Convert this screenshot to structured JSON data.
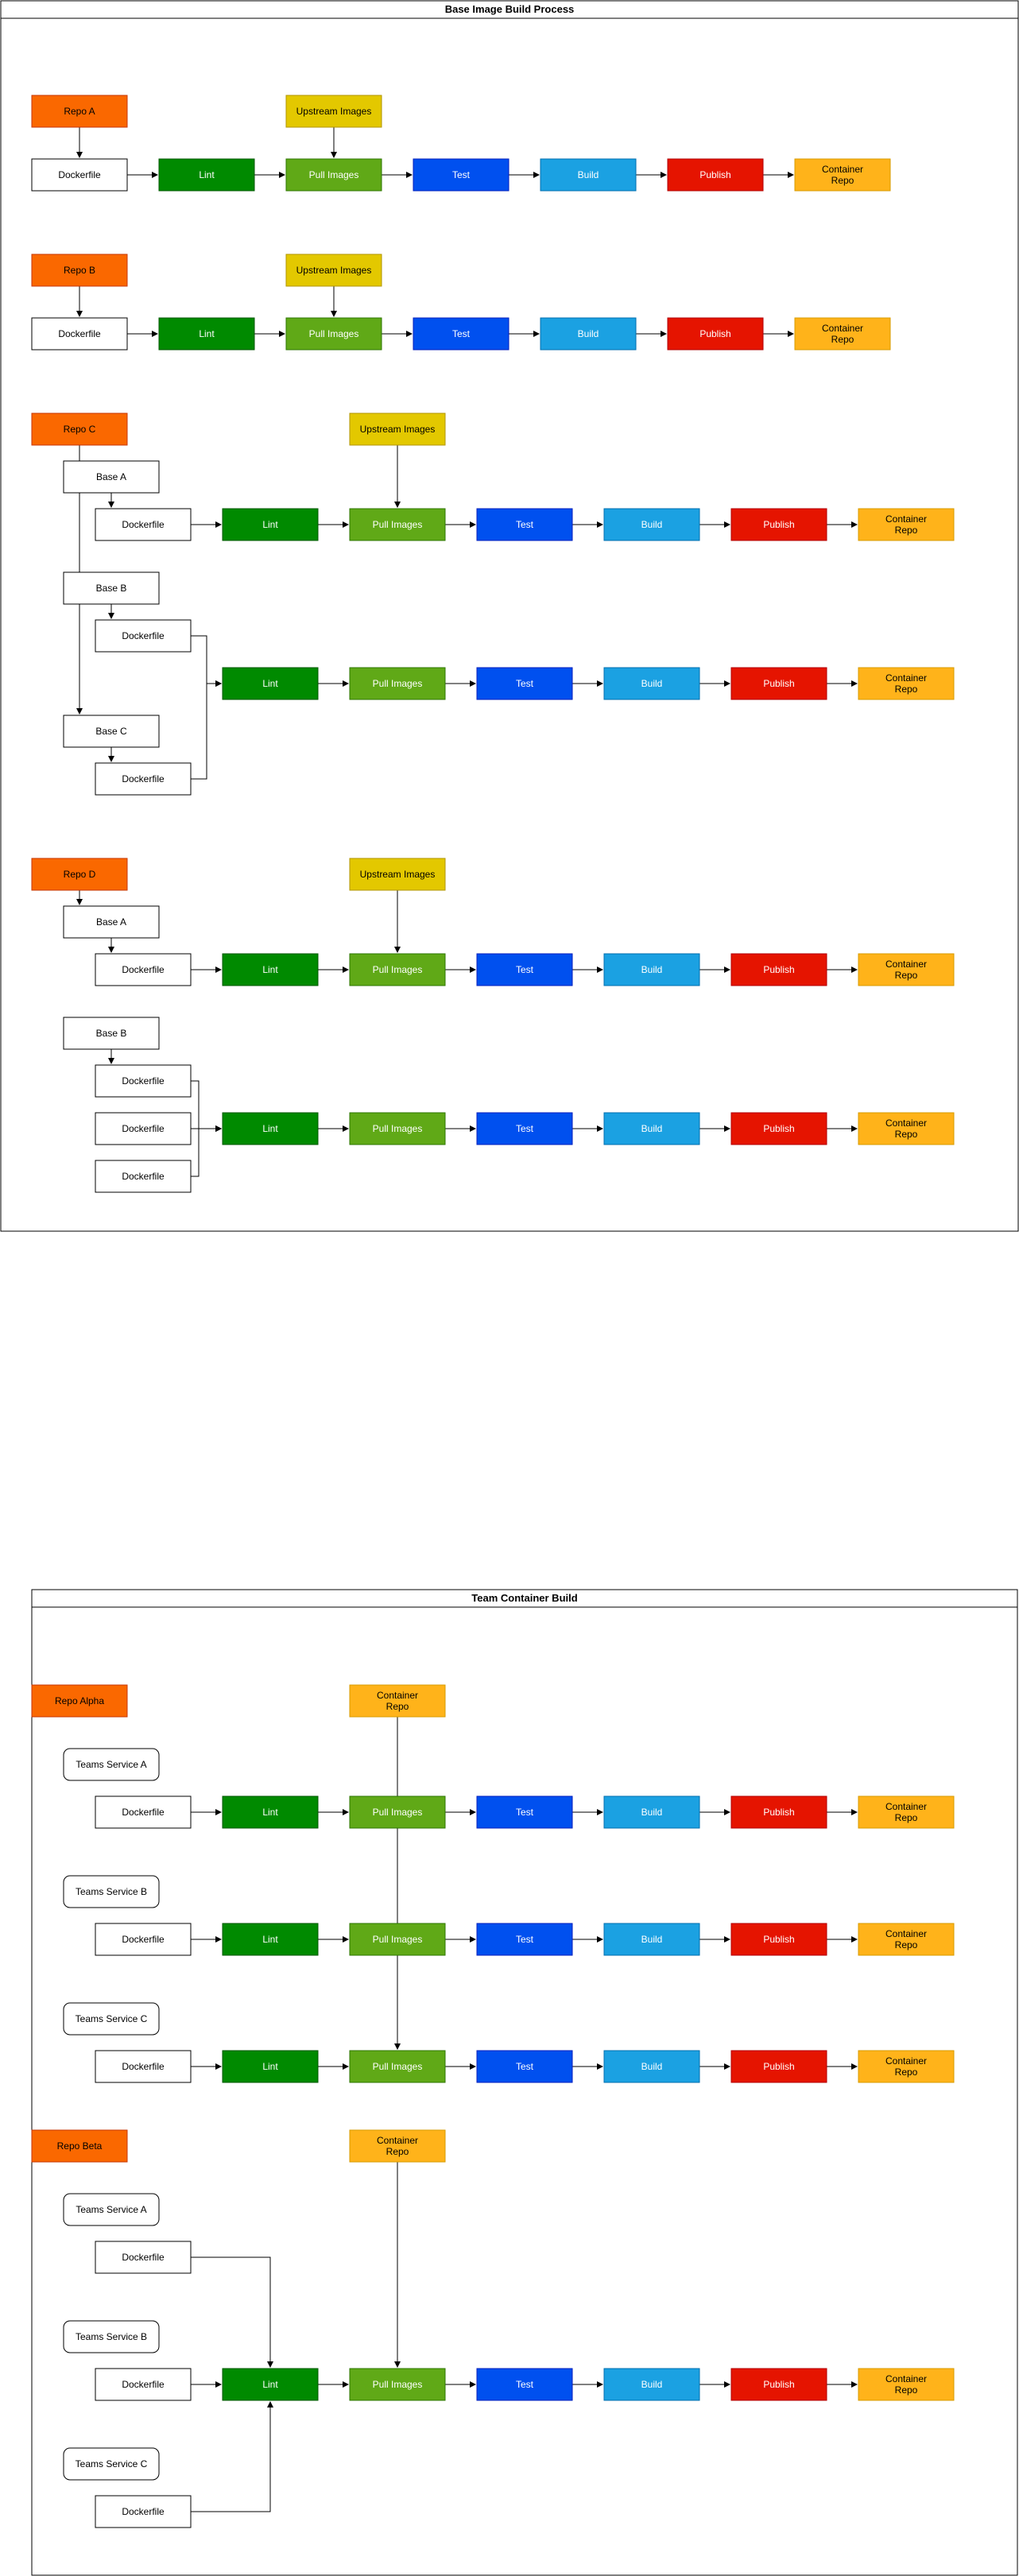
{
  "titles": {
    "base": "Base Image Build Process",
    "team": "Team Container Build"
  },
  "labels": {
    "repo_a": "Repo A",
    "repo_b": "Repo B",
    "repo_c": "Repo C",
    "repo_d": "Repo D",
    "repo_alpha": "Repo Alpha",
    "repo_beta": "Repo Beta",
    "upstream": "Upstream Images",
    "dockerfile": "Dockerfile",
    "lint": "Lint",
    "pull": "Pull Images",
    "test": "Test",
    "build": "Build",
    "publish": "Publish",
    "container_repo": [
      "Container",
      "Repo"
    ],
    "base_a": "Base A",
    "base_b": "Base B",
    "base_c": "Base C",
    "service_a": "Teams Service A",
    "service_b": "Teams Service B",
    "service_c": "Teams Service C"
  },
  "colors": {
    "repo": "#fa6800",
    "upstream": "#e3c800",
    "lint": "#008a00",
    "pull": "#60a917",
    "test": "#0050ef",
    "build": "#1ba1e2",
    "publish": "#e51400",
    "container": "#ffb31a",
    "border": "#000000"
  }
}
